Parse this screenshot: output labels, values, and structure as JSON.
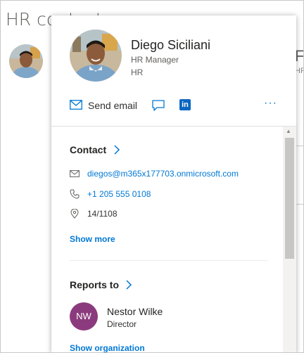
{
  "background": {
    "title": "HR contacts",
    "right_text": "Fo",
    "right_sub": "HR"
  },
  "card": {
    "name": "Diego Siciliani",
    "job_title": "HR Manager",
    "department": "HR",
    "actions": {
      "send_email_label": "Send email",
      "more_label": "···",
      "linkedin_label": "in"
    },
    "contact": {
      "title": "Contact",
      "email": "diegos@m365x177703.onmicrosoft.com",
      "phone": "+1 205 555 0108",
      "location": "14/1108",
      "show_more": "Show more"
    },
    "reports_to": {
      "title": "Reports to",
      "initials": "NW",
      "name": "Nestor Wilke",
      "title_text": "Director",
      "show_org": "Show organization"
    }
  },
  "colors": {
    "accent": "#0078d4",
    "avatar_nw": "#8b3b7d",
    "linkedin": "#0a66c2"
  },
  "icons": [
    "mail-icon",
    "chat-icon",
    "linkedin-icon",
    "more-icon",
    "chevron-right-icon",
    "phone-icon",
    "location-icon"
  ]
}
